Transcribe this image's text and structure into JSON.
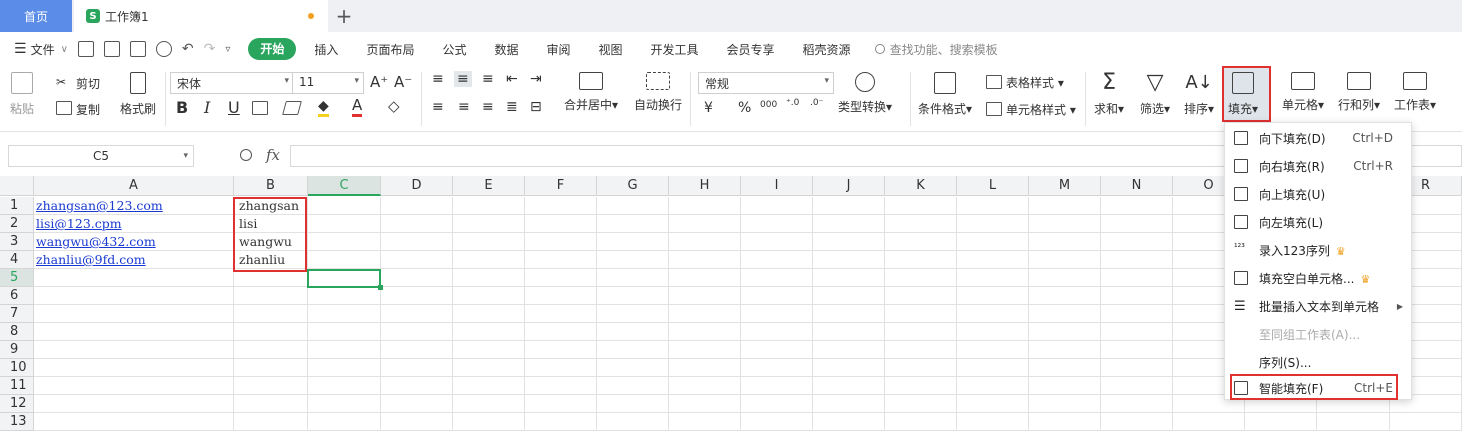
{
  "tabs": {
    "home": "首页",
    "doc": "工作簿1",
    "add": "+"
  },
  "menubar": {
    "file": "文件",
    "tabs": [
      "开始",
      "插入",
      "页面布局",
      "公式",
      "数据",
      "审阅",
      "视图",
      "开发工具",
      "会员专享",
      "稻壳资源"
    ],
    "search": "查找功能、搜索模板"
  },
  "ribbon": {
    "paste": "粘贴",
    "cut": "剪切",
    "copy": "复制",
    "format_painter": "格式刷",
    "font_name": "宋体",
    "font_size": "11",
    "merge": "合并居中",
    "wrap": "自动换行",
    "number_format": "常规",
    "type_convert": "类型转换",
    "cond_format": "条件格式",
    "table_style": "表格样式",
    "cell_style": "单元格样式",
    "sum": "求和",
    "filter": "筛选",
    "sort": "排序",
    "fill": "填充",
    "cell": "单元格",
    "row_col": "行和列",
    "worksheet": "工作表",
    "bold": "B",
    "italic": "I",
    "underline": "U",
    "currency": "¥",
    "percent": "%",
    "thousands": "000"
  },
  "formula": {
    "name_box": "C5",
    "fx": "fx",
    "value": ""
  },
  "grid": {
    "columns": [
      "A",
      "B",
      "C",
      "D",
      "E",
      "F",
      "G",
      "H",
      "I",
      "J",
      "K",
      "L",
      "M",
      "N",
      "O",
      "R"
    ],
    "rows": [
      "1",
      "2",
      "3",
      "4",
      "5",
      "6",
      "7",
      "8",
      "9",
      "10",
      "11",
      "12",
      "13"
    ],
    "col_a": [
      "zhangsan@123.com",
      "lisi@123.cpm",
      "wangwu@432.com",
      "zhanliu@9fd.com"
    ],
    "col_b": [
      "zhangsan",
      "lisi",
      "wangwu",
      "zhanliu"
    ]
  },
  "fill_menu": [
    {
      "label": "向下填充(D)",
      "shortcut": "Ctrl+D",
      "icon": "fill-down-icon"
    },
    {
      "label": "向右填充(R)",
      "shortcut": "Ctrl+R",
      "icon": "fill-right-icon"
    },
    {
      "label": "向上填充(U)",
      "shortcut": "",
      "icon": "fill-up-icon"
    },
    {
      "label": "向左填充(L)",
      "shortcut": "",
      "icon": "fill-left-icon"
    },
    {
      "label": "录入123序列",
      "shortcut": "",
      "icon": "sequence-icon"
    },
    {
      "label": "填充空白单元格...",
      "shortcut": "",
      "icon": "fill-blank-icon"
    },
    {
      "label": "批量插入文本到单元格",
      "shortcut": "",
      "icon": "batch-insert-icon"
    },
    {
      "label": "至同组工作表(A)...",
      "shortcut": "",
      "icon": ""
    },
    {
      "label": "序列(S)...",
      "shortcut": "",
      "icon": ""
    },
    {
      "label": "智能填充(F)",
      "shortcut": "Ctrl+E",
      "icon": "smart-fill-icon"
    }
  ],
  "colors": {
    "accent_green": "#2aa55e",
    "home_tab_blue": "#5b8de8",
    "highlight_red": "#e03030",
    "link_blue": "#1a3ad0"
  }
}
